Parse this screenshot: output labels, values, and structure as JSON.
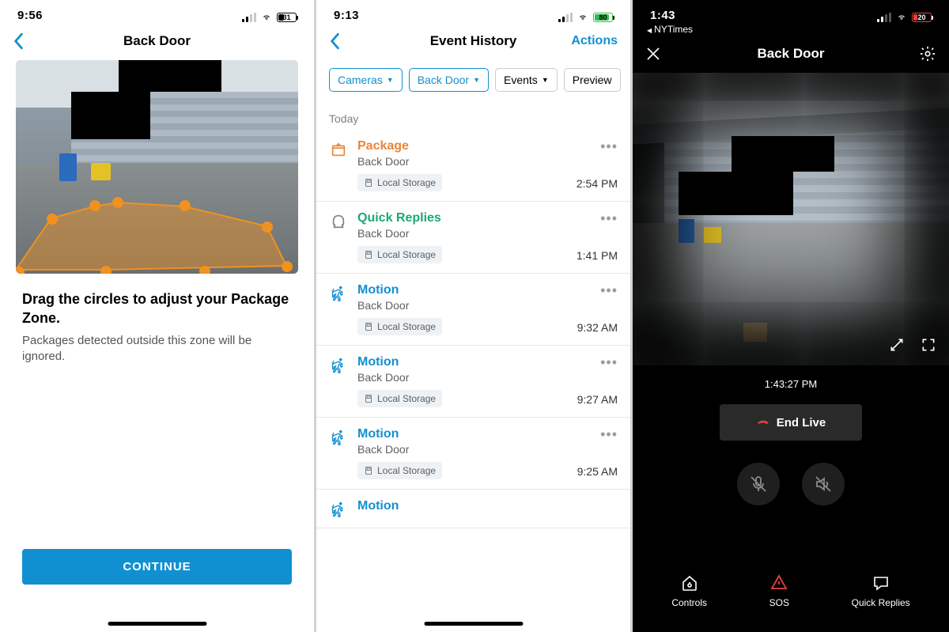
{
  "screen1": {
    "status": {
      "time": "9:56",
      "battery": "31"
    },
    "title": "Back Door",
    "heading": "Drag the circles to adjust your Package Zone.",
    "sub": "Packages detected outside this zone will be ignored.",
    "button": "CONTINUE"
  },
  "screen2": {
    "status": {
      "time": "9:13",
      "battery": "80"
    },
    "title": "Event History",
    "action": "Actions",
    "filters": {
      "cameras": "Cameras",
      "selected": "Back Door",
      "events": "Events",
      "preview": "Preview"
    },
    "section": "Today",
    "events": [
      {
        "type": "package",
        "title": "Package",
        "sub": "Back Door",
        "tag": "Local Storage",
        "time": "2:54 PM"
      },
      {
        "type": "quick",
        "title": "Quick Replies",
        "sub": "Back Door",
        "tag": "Local Storage",
        "time": "1:41 PM"
      },
      {
        "type": "motion",
        "title": "Motion",
        "sub": "Back Door",
        "tag": "Local Storage",
        "time": "9:32 AM"
      },
      {
        "type": "motion",
        "title": "Motion",
        "sub": "Back Door",
        "tag": "Local Storage",
        "time": "9:27 AM"
      },
      {
        "type": "motion",
        "title": "Motion",
        "sub": "Back Door",
        "tag": "Local Storage",
        "time": "9:25 AM"
      },
      {
        "type": "motion",
        "title": "Motion",
        "sub": "",
        "tag": "",
        "time": ""
      }
    ]
  },
  "screen3": {
    "status": {
      "time": "1:43",
      "battery": "20"
    },
    "breadcrumb": "NYTimes",
    "title": "Back Door",
    "timestamp": "1:43:27 PM",
    "end": "End Live",
    "nav": {
      "controls": "Controls",
      "sos": "SOS",
      "quick": "Quick Replies"
    }
  }
}
